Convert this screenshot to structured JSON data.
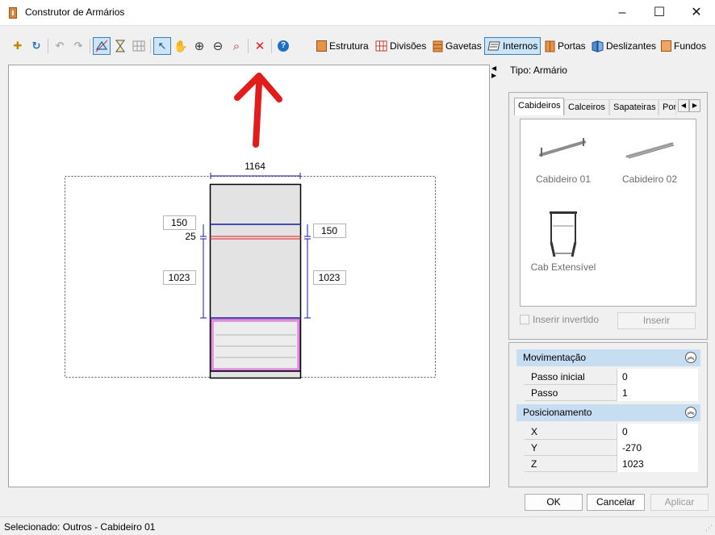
{
  "window": {
    "title": "Construtor de Armários",
    "minimize": "–",
    "maximize": "☐",
    "close": "✕"
  },
  "toolbar": {
    "text_buttons": [
      {
        "label": "Estrutura",
        "icon": "cabinet-structure-icon"
      },
      {
        "label": "Divisões",
        "icon": "grid-divisions-icon"
      },
      {
        "label": "Gavetas",
        "icon": "drawers-icon"
      },
      {
        "label": "Internos",
        "icon": "internals-icon",
        "active": true
      },
      {
        "label": "Portas",
        "icon": "doors-icon"
      },
      {
        "label": "Deslizantes",
        "icon": "sliding-doors-icon"
      },
      {
        "label": "Fundos",
        "icon": "back-panel-icon"
      }
    ],
    "glyphs": {
      "new": "✚",
      "refresh": "↻",
      "undo": "↶",
      "redo": "↷",
      "select": "↖",
      "pan": "✋",
      "zoom_in": "⊕",
      "zoom_out": "⊖",
      "zoom_fit": "⌕",
      "delete": "✕",
      "help": "?"
    }
  },
  "drawing": {
    "width_label": "1164",
    "left_dims": [
      "150",
      "25",
      "1023"
    ],
    "right_dims": [
      "150",
      "1023"
    ]
  },
  "panel": {
    "tipo": "Tipo: Armário",
    "tabs": [
      "Cabideiros",
      "Calceiros",
      "Sapateiras",
      "Por"
    ],
    "items": [
      "Cabideiro 01",
      "Cabideiro 02",
      "Cab Extensível"
    ],
    "invert_label": "Inserir invertido",
    "insert_label": "Inserir"
  },
  "properties": {
    "movimentacao": {
      "title": "Movimentação",
      "rows": [
        {
          "k": "Passo inicial",
          "v": "0"
        },
        {
          "k": "Passo",
          "v": "1"
        }
      ]
    },
    "posicionamento": {
      "title": "Posicionamento",
      "rows": [
        {
          "k": "X",
          "v": "0"
        },
        {
          "k": "Y",
          "v": "-270"
        },
        {
          "k": "Z",
          "v": "1023"
        }
      ]
    }
  },
  "buttons": {
    "ok": "OK",
    "cancel": "Cancelar",
    "apply": "Aplicar"
  },
  "status": "Selecionado: Outros - Cabideiro 01",
  "colors": {
    "accent": "#3c7fb1",
    "selection": "#cce4f7",
    "group_header": "#c7ddf2",
    "dimension": "#1a1aa8",
    "highlight_red": "#e01b1b",
    "drawer_magenta": "#c010c0"
  }
}
